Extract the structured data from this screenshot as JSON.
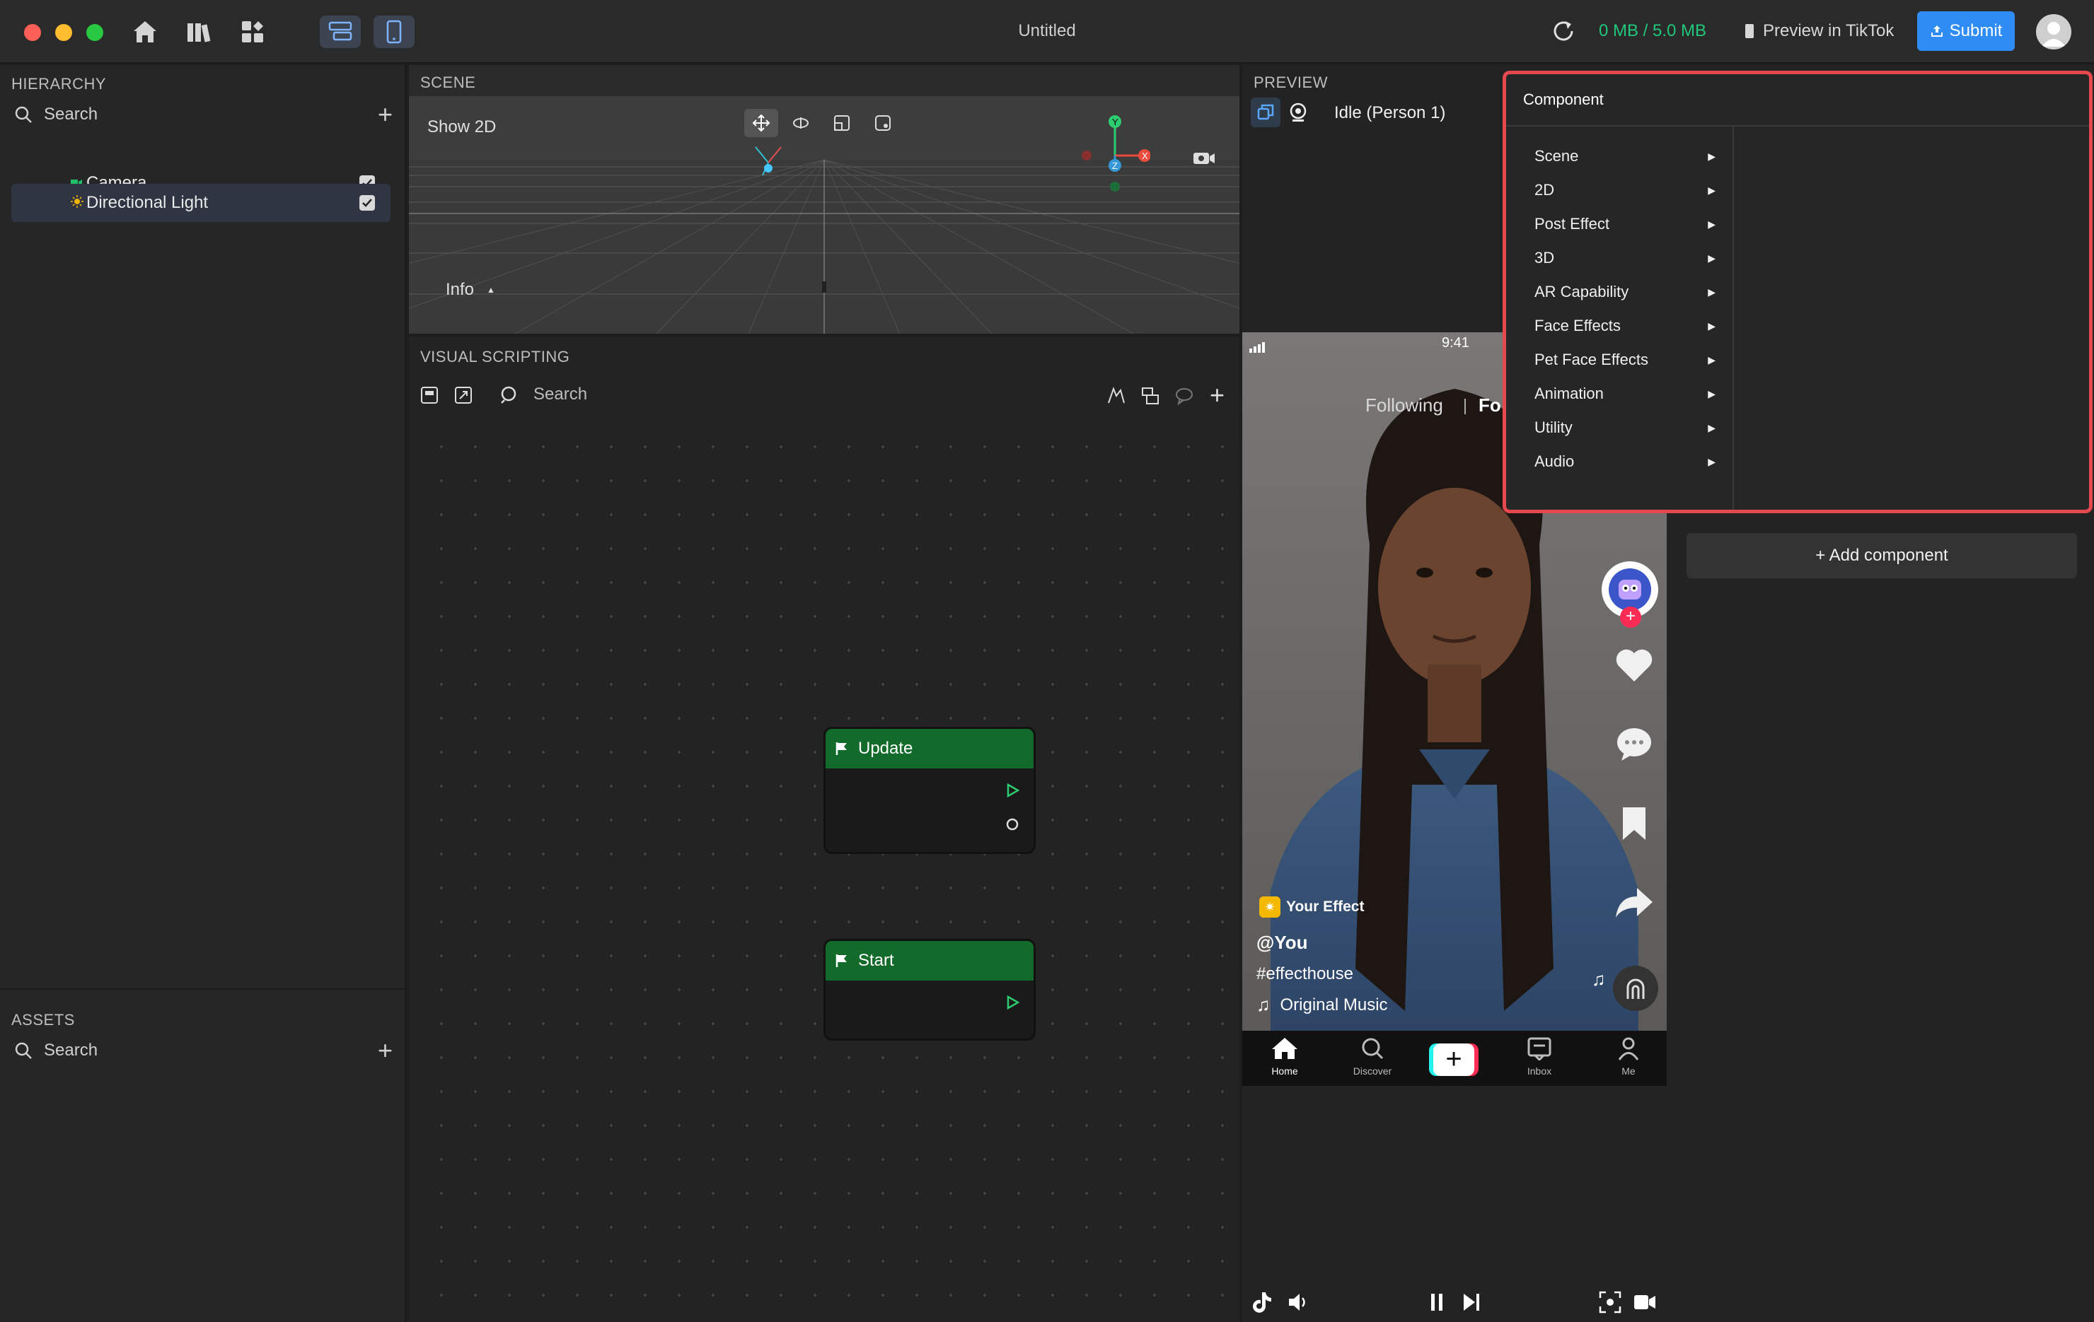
{
  "window": {
    "title": "Untitled"
  },
  "topbar": {
    "storage": "0 MB / 5.0 MB",
    "preview_label": "Preview in TikTok",
    "submit_label": "Submit"
  },
  "hierarchy": {
    "title": "HIERARCHY",
    "search_placeholder": "Search",
    "items": [
      {
        "label": "Camera",
        "checked": true,
        "selected": false
      },
      {
        "label": "Directional Light",
        "checked": true,
        "selected": true
      }
    ]
  },
  "assets": {
    "title": "ASSETS",
    "search_placeholder": "Search"
  },
  "scene": {
    "title": "SCENE",
    "show2d": "Show 2D",
    "info": "Info"
  },
  "visual_scripting": {
    "title": "VISUAL SCRIPTING",
    "search_placeholder": "Search",
    "nodes": [
      {
        "title": "Update"
      },
      {
        "title": "Start"
      }
    ]
  },
  "preview": {
    "title": "PREVIEW",
    "state": "Idle (Person 1)",
    "phone": {
      "time": "9:41",
      "tab_following": "Following",
      "tab_foryou": "Fo",
      "effect_tag": "Your Effect",
      "username": "@You",
      "hashtag": "#effecthouse",
      "music": "Original Music",
      "nav": [
        "Home",
        "Discover",
        "",
        "Inbox",
        "Me"
      ]
    }
  },
  "inspector": {
    "add_component": "+ Add component"
  },
  "component_menu": {
    "title": "Component",
    "items": [
      "Scene",
      "2D",
      "Post Effect",
      "3D",
      "AR Capability",
      "Face Effects",
      "Pet Face Effects",
      "Animation",
      "Utility",
      "Audio"
    ]
  },
  "colors": {
    "accent_blue": "#2f8cf4",
    "storage_green": "#21c77a",
    "node_header_green": "#136b2b",
    "highlight_red": "#e5484d"
  }
}
